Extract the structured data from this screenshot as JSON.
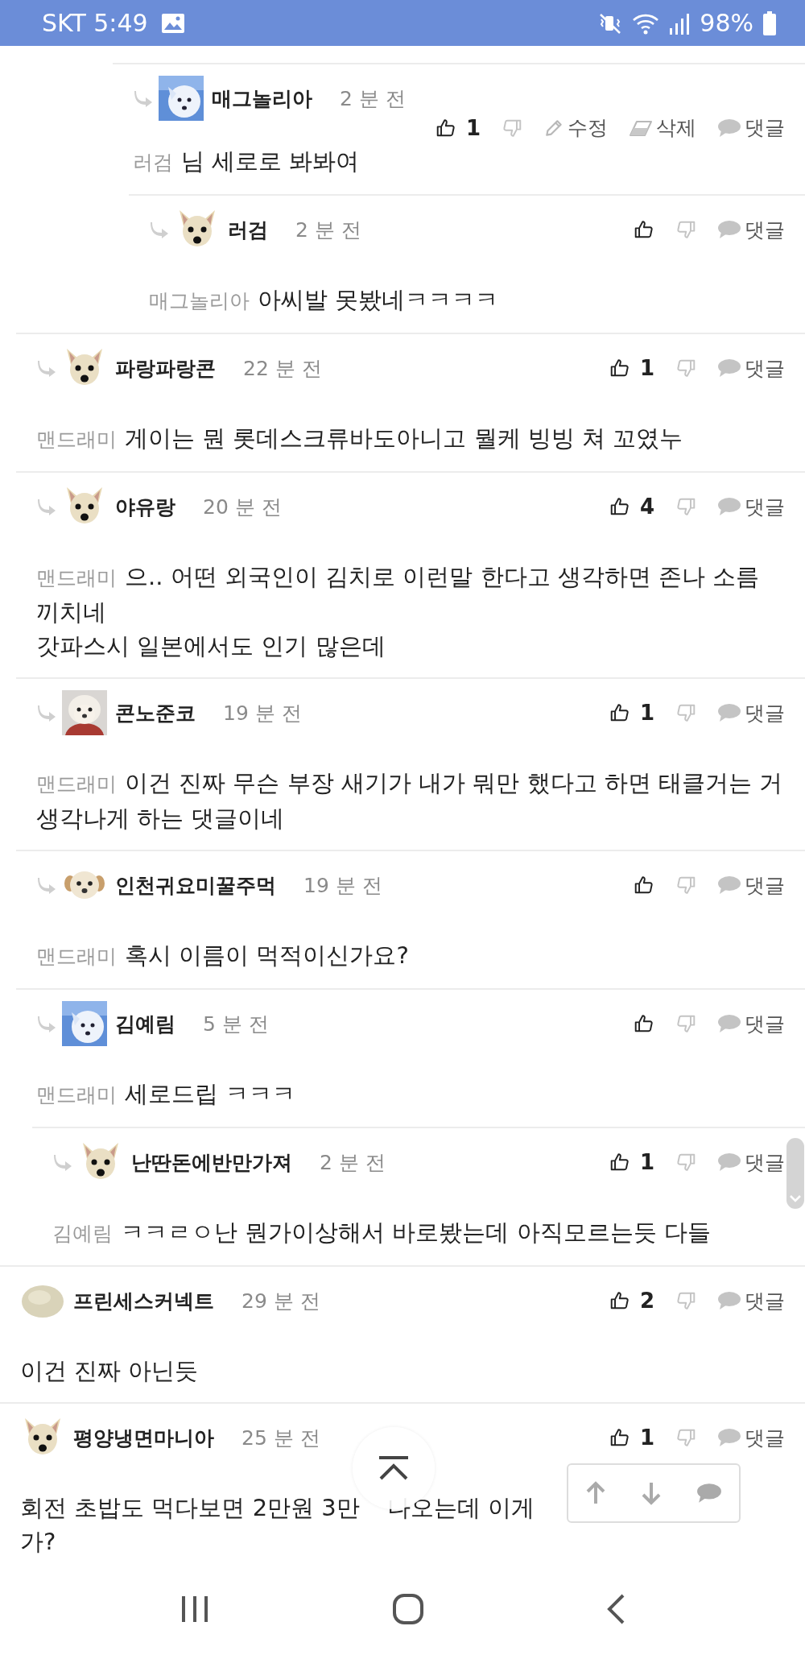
{
  "status_bar": {
    "carrier_time": "SKT 5:49",
    "battery": "98%"
  },
  "comments": [
    {
      "children": [
        {
          "children": [
            {
              "children": [
                {
                  "children": [
                    {
                      "children": [
                        {
                          "children": [
                            {
                              "children": [
                                {
                                  "author": "매그놀리아",
                                  "avatar": {
                                    "kind": "blue-dog"
                                  },
                                  "time": "2 분 전",
                                  "reply": true,
                                  "likes": "1",
                                  "owner_actions": [
                                    {
                                      "kind": "edit",
                                      "label": "수정"
                                    },
                                    {
                                      "kind": "delete",
                                      "label": "삭제"
                                    }
                                  ],
                                  "reply_label": "댓글",
                                  "mention": "러검",
                                  "lines": [
                                    [
                                      "님 세로로 봐봐여"
                                    ]
                                  ],
                                  "children": [
                                    {
                                      "author": "러검",
                                      "avatar": {
                                        "kind": "chihuahua"
                                      },
                                      "time": "2 분 전",
                                      "reply": true,
                                      "reply_label": "댓글",
                                      "mention": "매그놀리아",
                                      "lines": [
                                        [
                                          "아씨발 못봤네ㅋㅋㅋㅋ"
                                        ]
                                      ]
                                    }
                                  ]
                                }
                              ]
                            }
                          ]
                        }
                      ]
                    }
                  ]
                }
              ]
            }
          ]
        },
        {
          "author": "파랑파랑콘",
          "avatar": {
            "kind": "chihuahua"
          },
          "time": "22 분 전",
          "reply": true,
          "likes": "1",
          "reply_label": "댓글",
          "mention": "맨드래미",
          "lines": [
            [
              "게이는 뭔 롯데스크류바도아니고 뭘케 빙빙 쳐 꼬였누"
            ]
          ]
        },
        {
          "author": "야유랑",
          "avatar": {
            "kind": "chihuahua"
          },
          "time": "20 분 전",
          "reply": true,
          "likes": "4",
          "reply_label": "댓글",
          "mention": "맨드래미",
          "lines": [
            [
              "으.. 어떤 외국인이 김치로 이런말 한다고 생각하면 존나 소름 끼치네"
            ],
            [
              "갓파스시 일본에서도 인기 많은데"
            ]
          ]
        },
        {
          "author": "콘노준코",
          "avatar": {
            "kind": "puppy"
          },
          "time": "19 분 전",
          "reply": true,
          "likes": "1",
          "reply_label": "댓글",
          "mention": "맨드래미",
          "lines": [
            [
              "이건 진짜 무슨 부장 새기가 내가 뭐만 했다고 하면 태클거는 거 생각나게 하는 댓글이네"
            ]
          ]
        },
        {
          "author": "인천귀요미꿀주먹",
          "avatar": {
            "kind": "small-dog"
          },
          "time": "19 분 전",
          "reply": true,
          "reply_label": "댓글",
          "mention": "맨드래미",
          "lines": [
            [
              "혹시 이름이 먹적이신가요?"
            ]
          ]
        },
        {
          "author": "김예림",
          "avatar": {
            "kind": "blue-dog"
          },
          "time": "5 분 전",
          "reply": true,
          "reply_label": "댓글",
          "mention": "맨드래미",
          "lines": [
            [
              "세로드립 ㅋㅋㅋ"
            ]
          ],
          "children": [
            {
              "author": "난딴돈에반만가져",
              "avatar": {
                "kind": "chihuahua"
              },
              "time": "2 분 전",
              "reply": true,
              "likes": "1",
              "reply_label": "댓글",
              "mention": "김예림",
              "lines": [
                [
                  "ㅋㅋㄹㅇ난 뭔가이상해서 바로봤는데 아직모르는듯 다들"
                ]
              ]
            }
          ]
        }
      ]
    },
    {
      "author": "프린세스커넥트",
      "avatar": {
        "kind": "blob"
      },
      "time": "29 분 전",
      "reply": false,
      "likes": "2",
      "reply_label": "댓글",
      "lines": [
        [
          "이건 진짜 아닌듯"
        ]
      ]
    },
    {
      "author": "평양냉면마니아",
      "avatar": {
        "kind": "chihuahua"
      },
      "time": "25 분 전",
      "reply": false,
      "likes": "1",
      "reply_label": "댓글",
      "lines": [
        [
          "회전 초밥도 먹다보면 2만원 3만",
          "나오는데 이게"
        ],
        [
          "가?"
        ]
      ]
    }
  ]
}
